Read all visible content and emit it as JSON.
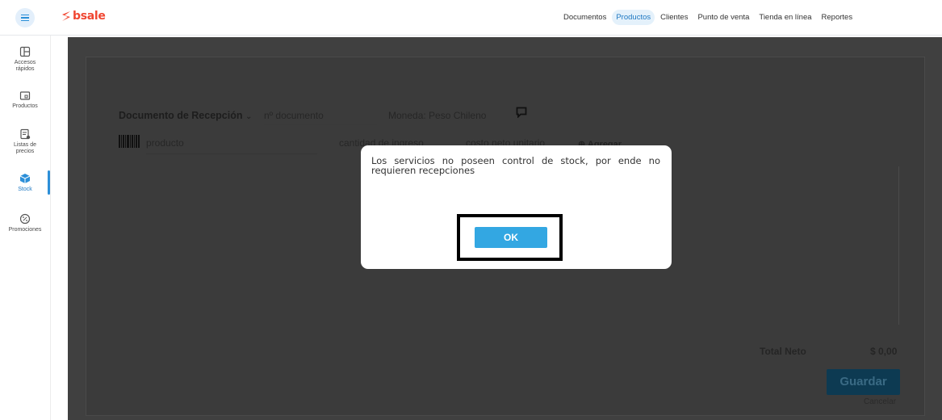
{
  "brand": {
    "logo_text": "bsale",
    "color": "#f04631"
  },
  "nav": {
    "items": [
      {
        "label": "Documentos",
        "active": false
      },
      {
        "label": "Productos",
        "active": true
      },
      {
        "label": "Clientes",
        "active": false
      },
      {
        "label": "Punto de venta",
        "active": false
      },
      {
        "label": "Tienda en línea",
        "active": false
      },
      {
        "label": "Reportes",
        "active": false
      }
    ]
  },
  "sidebar": {
    "items": [
      {
        "label_line1": "Accesos",
        "label_line2": "rápidos",
        "icon": "layout-icon"
      },
      {
        "label_line1": "Productos",
        "label_line2": "",
        "icon": "product-icon"
      },
      {
        "label_line1": "Listas de",
        "label_line2": "precios",
        "icon": "price-list-icon"
      },
      {
        "label_line1": "Stock",
        "label_line2": "",
        "icon": "box-icon",
        "active": true
      },
      {
        "label_line1": "Promociones",
        "label_line2": "",
        "icon": "discount-icon"
      }
    ]
  },
  "form": {
    "doc_type": "Documento de Recepción",
    "doc_number_placeholder": "nº documento",
    "currency": "Moneda: Peso Chileno",
    "product_placeholder": "producto",
    "quantity_placeholder": "cantidad de ingreso",
    "cost_placeholder": "costo neto unitario",
    "add_label": "Agregar"
  },
  "totals": {
    "label": "Total Neto",
    "value": "$ 0,00"
  },
  "actions": {
    "save": "Guardar",
    "cancel": "Cancelar"
  },
  "modal": {
    "message": "Los servicios no poseen control de stock, por ende no requieren recepciones",
    "ok": "OK"
  },
  "colors": {
    "accent": "#2c8fd8",
    "ok_button": "#33a7e2",
    "overlay": "#404040"
  }
}
